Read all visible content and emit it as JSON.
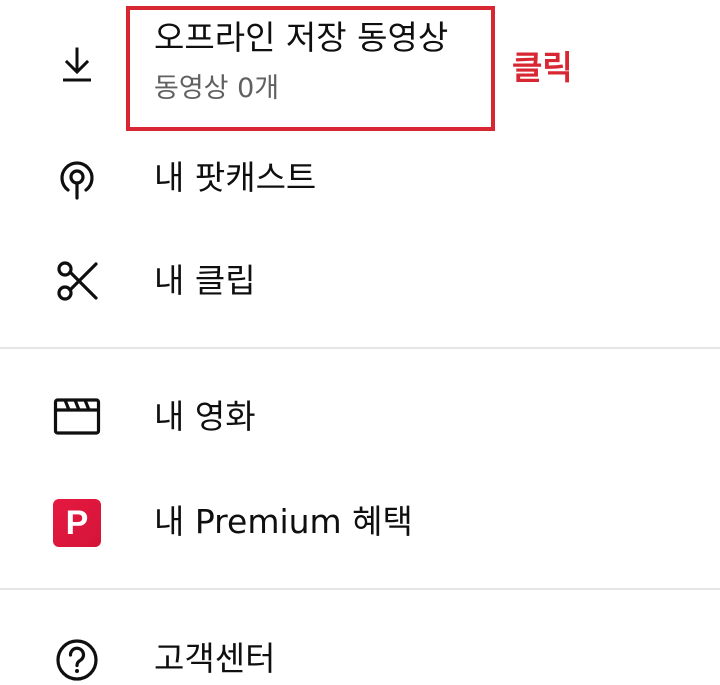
{
  "menu": {
    "downloads": {
      "label": "오프라인 저장 동영상",
      "sublabel": "동영상 0개"
    },
    "podcasts": {
      "label": "내 팟캐스트"
    },
    "clips": {
      "label": "내 클립"
    },
    "movies": {
      "label": "내 영화"
    },
    "premium": {
      "label": "내 Premium 혜택",
      "badge": "P"
    },
    "help": {
      "label": "고객센터"
    }
  },
  "annotation": {
    "text": "클릭",
    "color": "#d92633"
  },
  "icons": {
    "downloads": "download-icon",
    "podcasts": "podcast-icon",
    "clips": "scissors-icon",
    "movies": "clapperboard-icon",
    "premium": "premium-badge-icon",
    "help": "help-circle-icon"
  },
  "colors": {
    "premium": "#e6193f",
    "text_primary": "#0f0f0f",
    "text_secondary": "#606060",
    "divider": "#e5e5e5"
  }
}
